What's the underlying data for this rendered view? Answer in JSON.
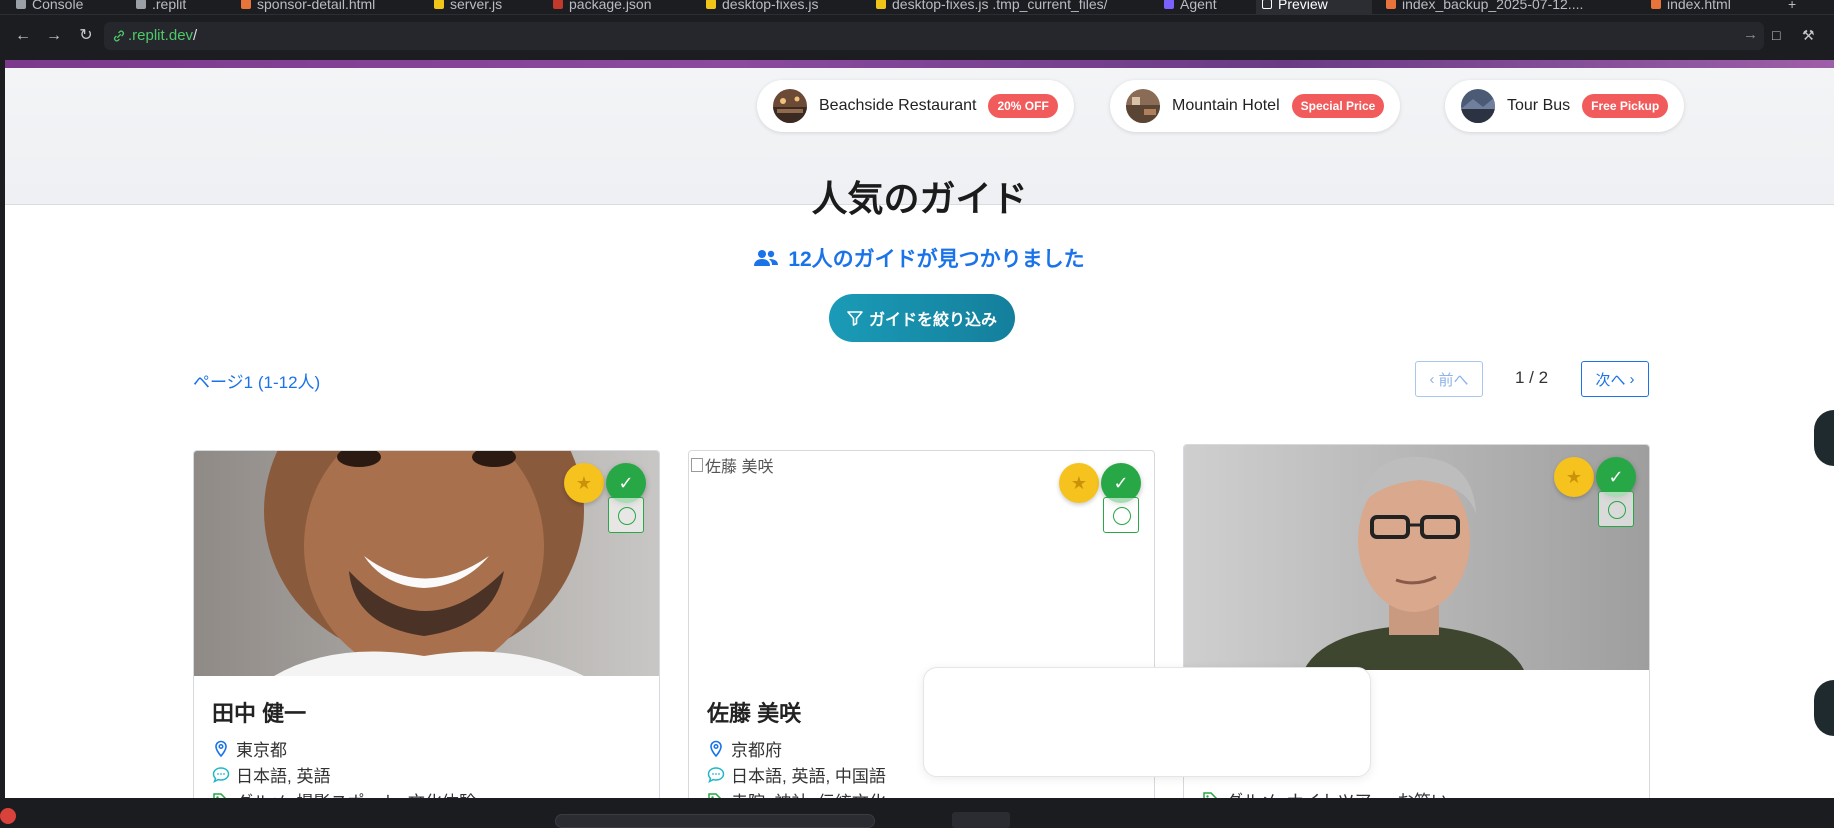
{
  "tabs": [
    {
      "label": "Console",
      "color": "#9aa0a6"
    },
    {
      "label": ".replit",
      "color": "#9aa0a6"
    },
    {
      "label": "sponsor-detail.html",
      "color": "#e8743b"
    },
    {
      "label": "server.js",
      "color": "#f0c419"
    },
    {
      "label": "package.json",
      "color": "#c0392b"
    },
    {
      "label": "desktop-fixes.js",
      "color": "#f0c419"
    },
    {
      "label": "desktop-fixes.js .tmp_current_files/",
      "color": "#f0c419"
    },
    {
      "label": "Agent",
      "color": "#7b61ff"
    },
    {
      "label": "Preview",
      "color": "#ffffff",
      "active": true
    },
    {
      "label": "index_backup_2025-07-12....",
      "color": "#e8743b"
    },
    {
      "label": "index.html",
      "color": "#e8743b"
    },
    {
      "label": "+",
      "color": "#9aa0a6"
    }
  ],
  "browser": {
    "url_host": ".replit.dev",
    "url_path": "/"
  },
  "sponsors": [
    {
      "name": "Beachside Restaurant",
      "badge": "20% OFF"
    },
    {
      "name": "Mountain Hotel",
      "badge": "Special Price"
    },
    {
      "name": "Tour Bus",
      "badge": "Free Pickup"
    }
  ],
  "page": {
    "title": "人気のガイド",
    "count_text": "12人のガイドが見つかりました",
    "filter_label": "ガイドを絞り込み",
    "page_info": "ページ1 (1-12人)",
    "prev_label": "前へ",
    "next_label": "次へ",
    "page_number": "1 / 2"
  },
  "guides": [
    {
      "name": "田中 健一",
      "location": "東京都",
      "languages": "日本語, 英語",
      "specialties": "グルメ, 撮影スポット, 文化体験"
    },
    {
      "name": "佐藤 美咲",
      "image_alt": "佐藤 美咲",
      "location": "京都府",
      "languages": "日本語, 英語, 中国語",
      "specialties": "寺院, 神社, 伝統文化"
    },
    {
      "name": "",
      "specialties": "グルメ, ナイトツアー, お笑い"
    }
  ],
  "colors": {
    "accent": "#1a73e8",
    "badge_red": "#f25b5b",
    "star": "#f6c21d",
    "verified": "#27a745",
    "filter_btn": "#1a9bb7"
  }
}
